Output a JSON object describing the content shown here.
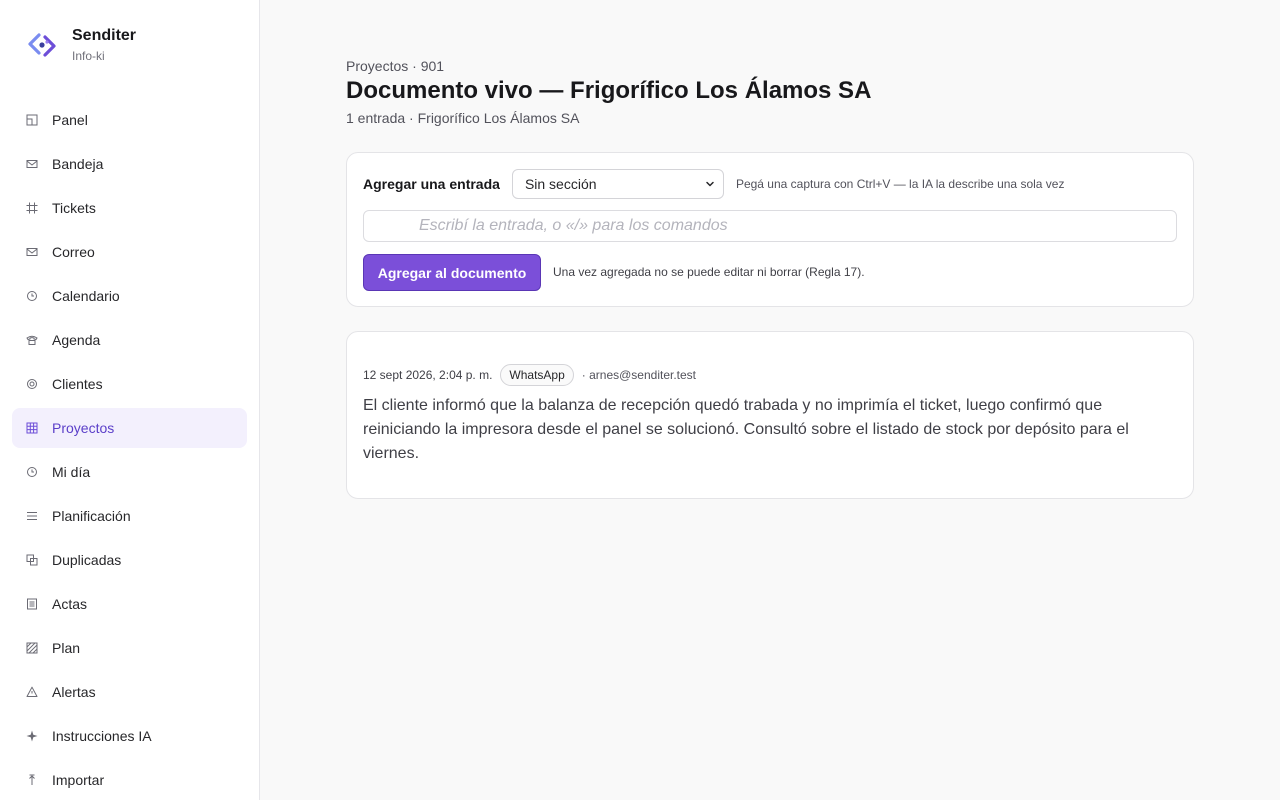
{
  "brand": {
    "name": "Senditer",
    "subtitle": "Info-ki"
  },
  "sidebar": {
    "items": [
      {
        "label": "Panel",
        "icon": "panel-icon",
        "active": false
      },
      {
        "label": "Bandeja",
        "icon": "inbox-icon",
        "active": false
      },
      {
        "label": "Tickets",
        "icon": "hash-icon",
        "active": false
      },
      {
        "label": "Correo",
        "icon": "mail-icon",
        "active": false
      },
      {
        "label": "Calendario",
        "icon": "clock-icon",
        "active": false
      },
      {
        "label": "Agenda",
        "icon": "phone-icon",
        "active": false
      },
      {
        "label": "Clientes",
        "icon": "target-icon",
        "active": false
      },
      {
        "label": "Proyectos",
        "icon": "grid-icon",
        "active": true
      },
      {
        "label": "Mi día",
        "icon": "clock-icon",
        "active": false
      },
      {
        "label": "Planificación",
        "icon": "list-icon",
        "active": false
      },
      {
        "label": "Duplicadas",
        "icon": "copy-icon",
        "active": false
      },
      {
        "label": "Actas",
        "icon": "document-icon",
        "active": false
      },
      {
        "label": "Plan",
        "icon": "hatched-square-icon",
        "active": false
      },
      {
        "label": "Alertas",
        "icon": "alert-triangle-icon",
        "active": false
      },
      {
        "label": "Instrucciones IA",
        "icon": "sparkle-icon",
        "active": false
      },
      {
        "label": "Importar",
        "icon": "upload-icon",
        "active": false
      }
    ]
  },
  "header": {
    "breadcrumb": "Proyectos · 901",
    "title": "Documento vivo — Frigorífico Los Álamos SA",
    "subtitle": "1 entrada · Frigorífico Los Álamos SA"
  },
  "entry_form": {
    "label": "Agregar una entrada",
    "section_select": "Sin sección",
    "hint": "Pegá una captura con Ctrl+V — la IA la describe una sola vez",
    "input_placeholder": "Escribí la entrada, o «/» para los comandos",
    "submit_label": "Agregar al documento",
    "rule_note": "Una vez agregada no se puede editar ni borrar (Regla 17)."
  },
  "entries": [
    {
      "timestamp": "12 sept 2026, 2:04 p. m.",
      "channel": "WhatsApp",
      "author": "· arnes@senditer.test",
      "text": "El cliente informó que la balanza de recepción quedó trabada y no imprimía el ticket, luego confirmó que reiniciando la impresora desde el panel se solucionó. Consultó sobre el listado de stock por depósito para el viernes."
    }
  ],
  "colors": {
    "accent": "#7b4fd9",
    "active_nav_bg": "#f3f0fd",
    "active_nav_text": "#5b3fc9",
    "background": "#f9f9f9"
  }
}
